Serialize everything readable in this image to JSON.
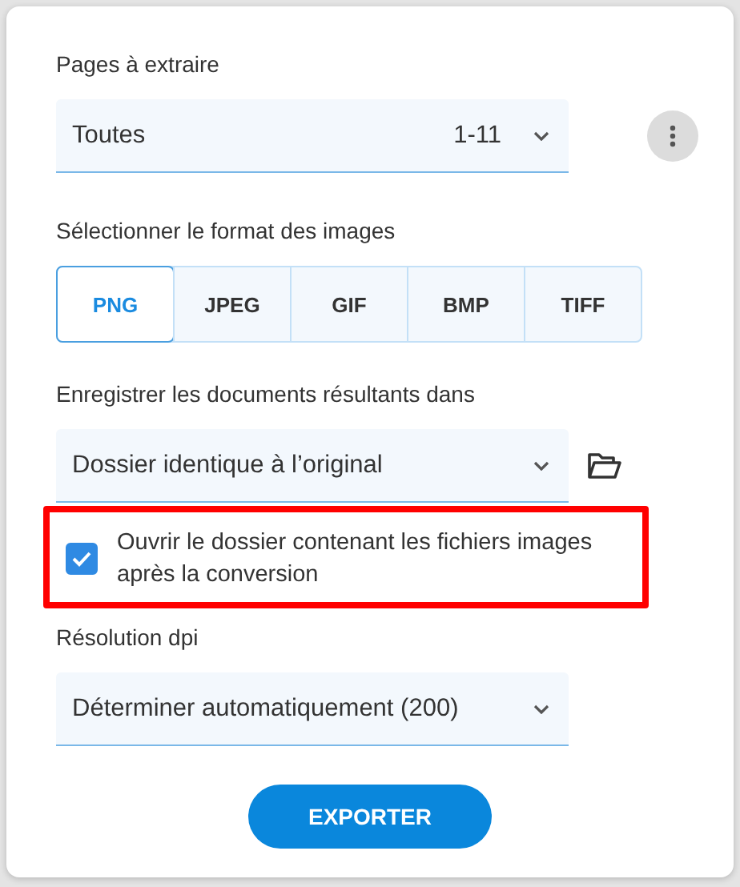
{
  "pages": {
    "label": "Pages à extraire",
    "value": "Toutes",
    "range": "1-11"
  },
  "format": {
    "label": "Sélectionner le format des images",
    "options": [
      {
        "label": "PNG",
        "selected": true
      },
      {
        "label": "JPEG",
        "selected": false
      },
      {
        "label": "GIF",
        "selected": false
      },
      {
        "label": "BMP",
        "selected": false
      },
      {
        "label": "TIFF",
        "selected": false
      }
    ]
  },
  "destination": {
    "label": "Enregistrer les documents résultants dans",
    "value": "Dossier identique à l’original"
  },
  "open_folder": {
    "label": "Ouvrir le dossier contenant les fichiers images après la conversion",
    "checked": true,
    "highlighted": true
  },
  "resolution": {
    "label": "Résolution dpi",
    "value": "Déterminer automatiquement (200)"
  },
  "button": "EXPORTER"
}
